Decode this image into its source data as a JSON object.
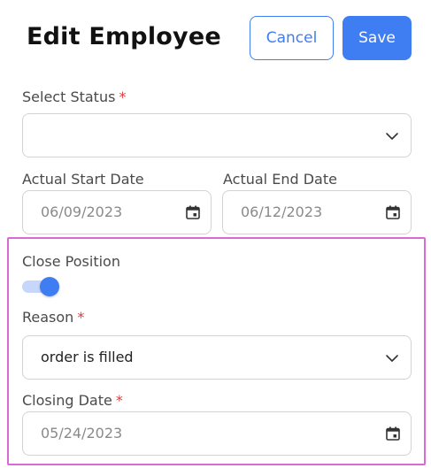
{
  "header": {
    "title": "Edit Employee",
    "cancel_label": "Cancel",
    "save_label": "Save"
  },
  "form": {
    "status": {
      "label": "Select Status",
      "required_mark": "*",
      "value": ""
    },
    "start_date": {
      "label": "Actual Start Date",
      "value": "06/09/2023"
    },
    "end_date": {
      "label": "Actual End Date",
      "value": "06/12/2023"
    },
    "close_position": {
      "label": "Close Position",
      "on": true
    },
    "reason": {
      "label": "Reason",
      "required_mark": "*",
      "value": "order is filled"
    },
    "closing_date": {
      "label": "Closing Date",
      "required_mark": "*",
      "value": "05/24/2023"
    }
  },
  "icons": {
    "dropdown": "chevron-down-icon",
    "date": "calendar-icon"
  },
  "colors": {
    "accent": "#3f7df3",
    "required": "#e03a3a",
    "highlight": "#d86ad8"
  }
}
